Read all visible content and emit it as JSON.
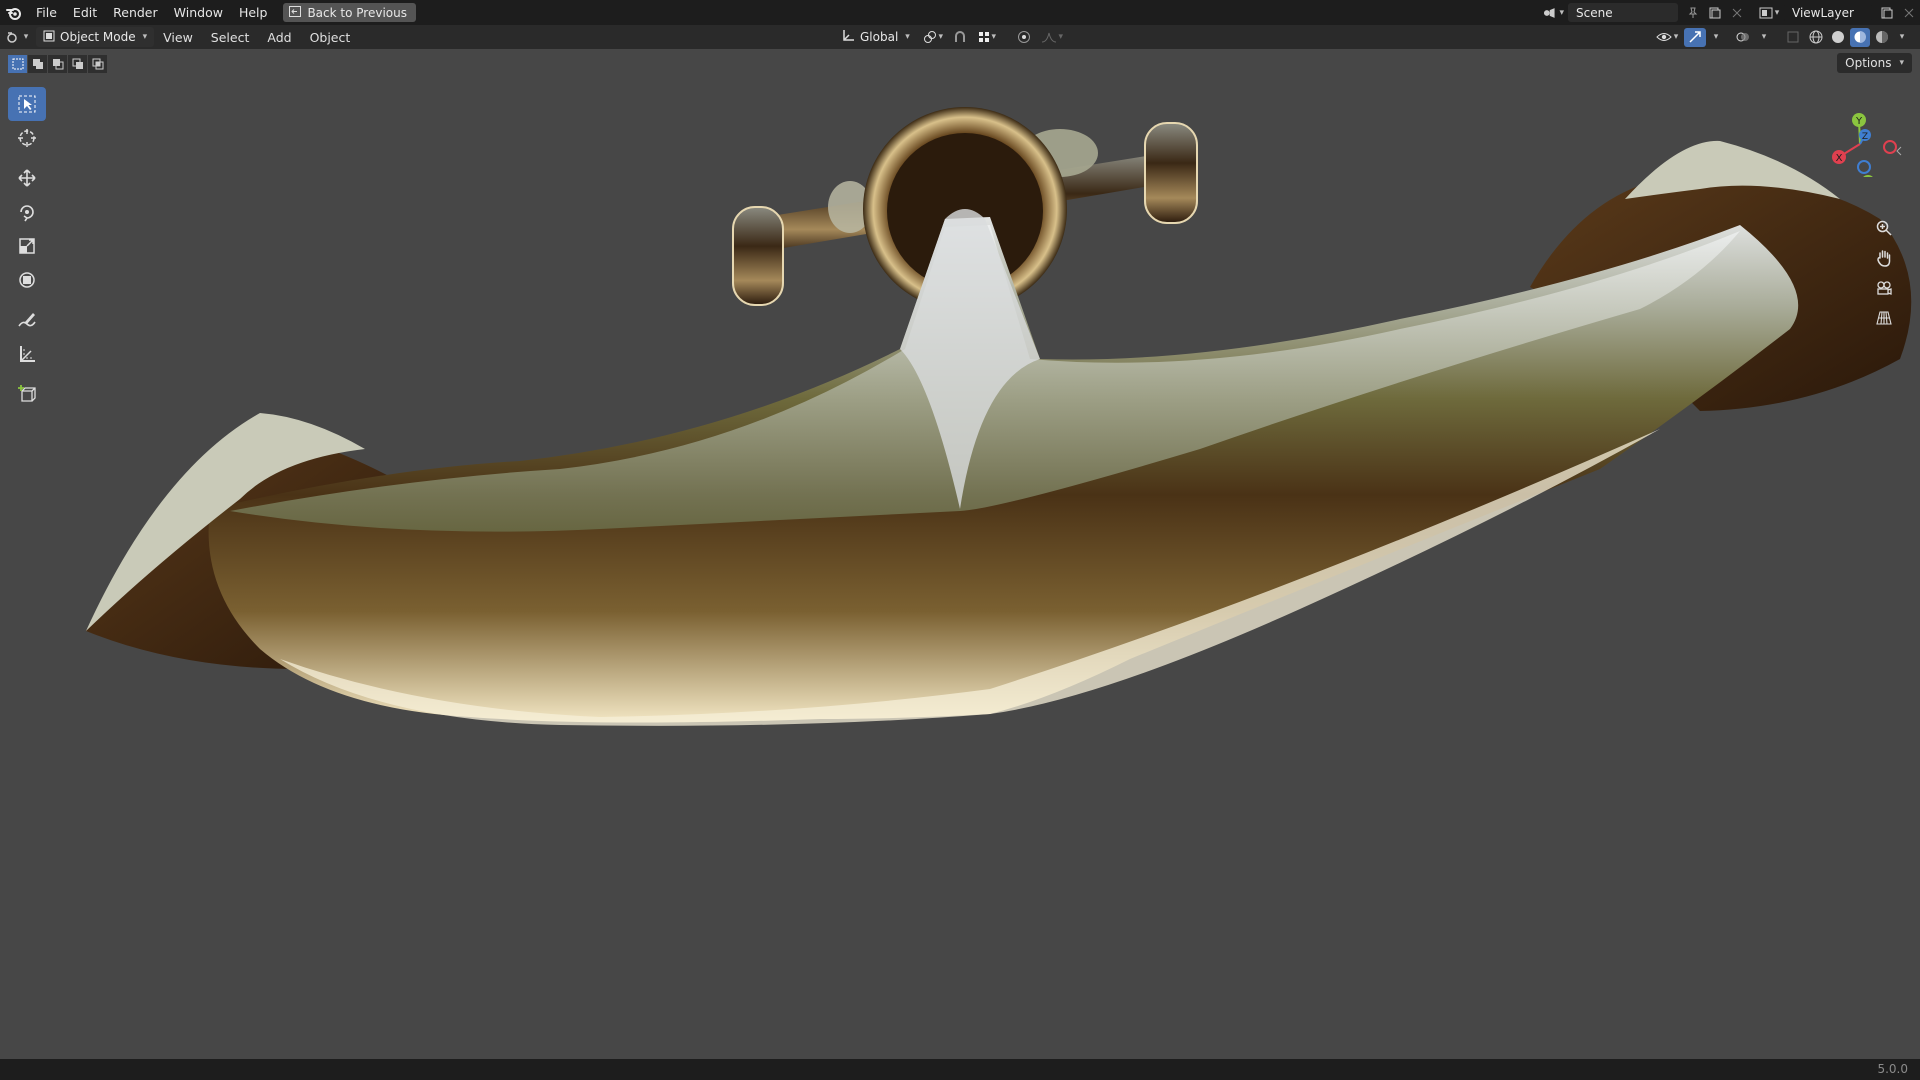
{
  "topbar": {
    "menus": [
      "File",
      "Edit",
      "Render",
      "Window",
      "Help"
    ],
    "back_button": "Back to Previous",
    "scene": "Scene",
    "view_layer": "ViewLayer"
  },
  "header": {
    "mode": "Object Mode",
    "menus": [
      "View",
      "Select",
      "Add",
      "Object"
    ],
    "orientation": "Global"
  },
  "viewport": {
    "options_label": "Options",
    "gizmo": {
      "x": "X",
      "y": "Y",
      "z": "Z"
    }
  },
  "statusbar": {
    "version": "5.0.0"
  },
  "colors": {
    "accent": "#4772b3",
    "topbar_bg": "#1d1d1d",
    "header_bg": "#2a2a2a",
    "viewport_bg": "#474747",
    "axis_x": "#e0404f",
    "axis_y": "#8bc53f",
    "axis_z": "#3f7ed1"
  }
}
